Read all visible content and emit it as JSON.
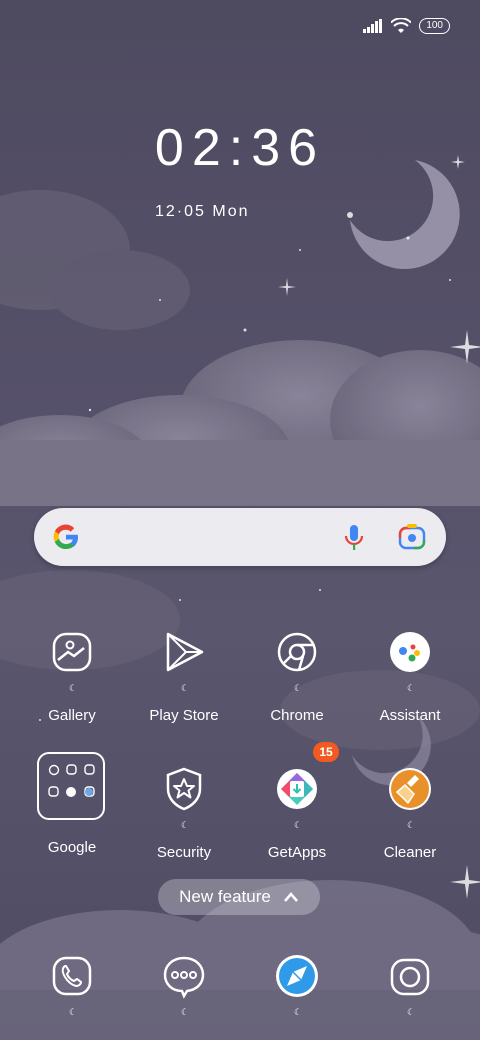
{
  "status": {
    "battery": "100"
  },
  "clock": {
    "time": "02:36",
    "date": "12·05  Mon"
  },
  "search": {
    "mic": "microphone-icon",
    "lens": "lens-icon"
  },
  "apps_row1": [
    {
      "label": "Gallery",
      "icon": "gallery-icon"
    },
    {
      "label": "Play Store",
      "icon": "play-store-icon"
    },
    {
      "label": "Chrome",
      "icon": "chrome-icon"
    },
    {
      "label": "Assistant",
      "icon": "assistant-icon"
    }
  ],
  "apps_row2": [
    {
      "label": "Google",
      "icon": "google-folder-icon"
    },
    {
      "label": "Security",
      "icon": "security-icon"
    },
    {
      "label": "GetApps",
      "icon": "getapps-icon",
      "badge": "15"
    },
    {
      "label": "Cleaner",
      "icon": "cleaner-icon"
    }
  ],
  "new_feature": {
    "label": "New feature"
  },
  "dock": [
    {
      "icon": "phone-icon"
    },
    {
      "icon": "messages-icon"
    },
    {
      "icon": "browser-icon"
    },
    {
      "icon": "camera-icon"
    }
  ],
  "colors": {
    "badge": "#f25a22",
    "cleaner": "#e8902a",
    "browser": "#2f9ae8"
  }
}
